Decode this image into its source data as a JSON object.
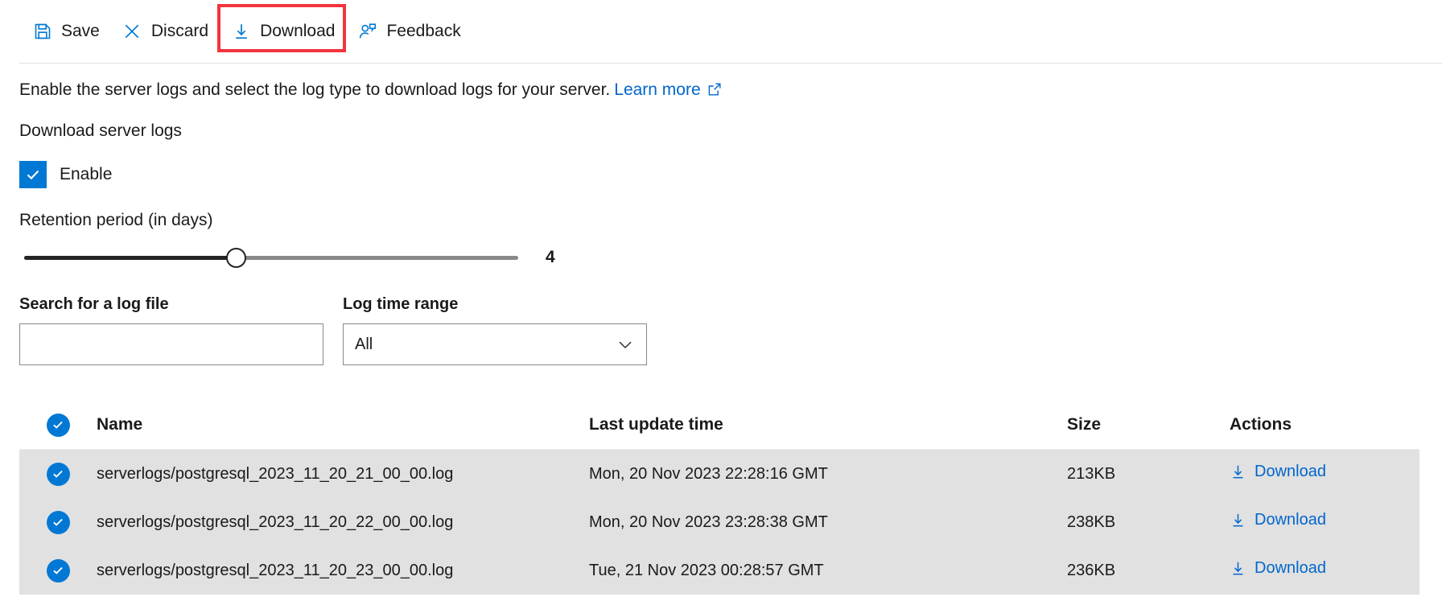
{
  "toolbar": {
    "buttons": [
      {
        "label": "Save",
        "icon": "save-icon"
      },
      {
        "label": "Discard",
        "icon": "discard-icon"
      },
      {
        "label": "Download",
        "icon": "download-icon"
      },
      {
        "label": "Feedback",
        "icon": "feedback-icon"
      }
    ],
    "highlight": {
      "target": "Download",
      "color": "#f4333d"
    }
  },
  "description": {
    "text": "Enable the server logs and select the log type to download logs for your server.",
    "link_label": "Learn more",
    "link_icon": "external-link-icon"
  },
  "section": {
    "title": "Download server logs",
    "enable_label": "Enable",
    "enable_checked": true,
    "retention_label": "Retention period (in days)",
    "retention_value": "4",
    "retention_percent": 42
  },
  "filters": {
    "search": {
      "label": "Search for a log file",
      "value": "",
      "placeholder": ""
    },
    "time_range": {
      "label": "Log time range",
      "value": "All",
      "options": [
        "All"
      ],
      "icon": "chevron-down-icon"
    }
  },
  "table": {
    "columns": {
      "name": "Name",
      "last_update": "Last update time",
      "size": "Size",
      "actions": "Actions"
    },
    "select_all_checked": true,
    "action_label": "Download",
    "rows": [
      {
        "checked": true,
        "name": "serverlogs/postgresql_2023_11_20_21_00_00.log",
        "last_update": "Mon, 20 Nov 2023 22:28:16 GMT",
        "size": "213KB",
        "action": "Download"
      },
      {
        "checked": true,
        "name": "serverlogs/postgresql_2023_11_20_22_00_00.log",
        "last_update": "Mon, 20 Nov 2023 23:28:38 GMT",
        "size": "238KB",
        "action": "Download"
      },
      {
        "checked": true,
        "name": "serverlogs/postgresql_2023_11_20_23_00_00.log",
        "last_update": "Tue, 21 Nov 2023 00:28:57 GMT",
        "size": "236KB",
        "action": "Download"
      }
    ]
  },
  "colors": {
    "accent": "#0078d4",
    "link": "#0066cc",
    "highlight": "#f4333d",
    "row_bg": "#e1e1e1"
  }
}
